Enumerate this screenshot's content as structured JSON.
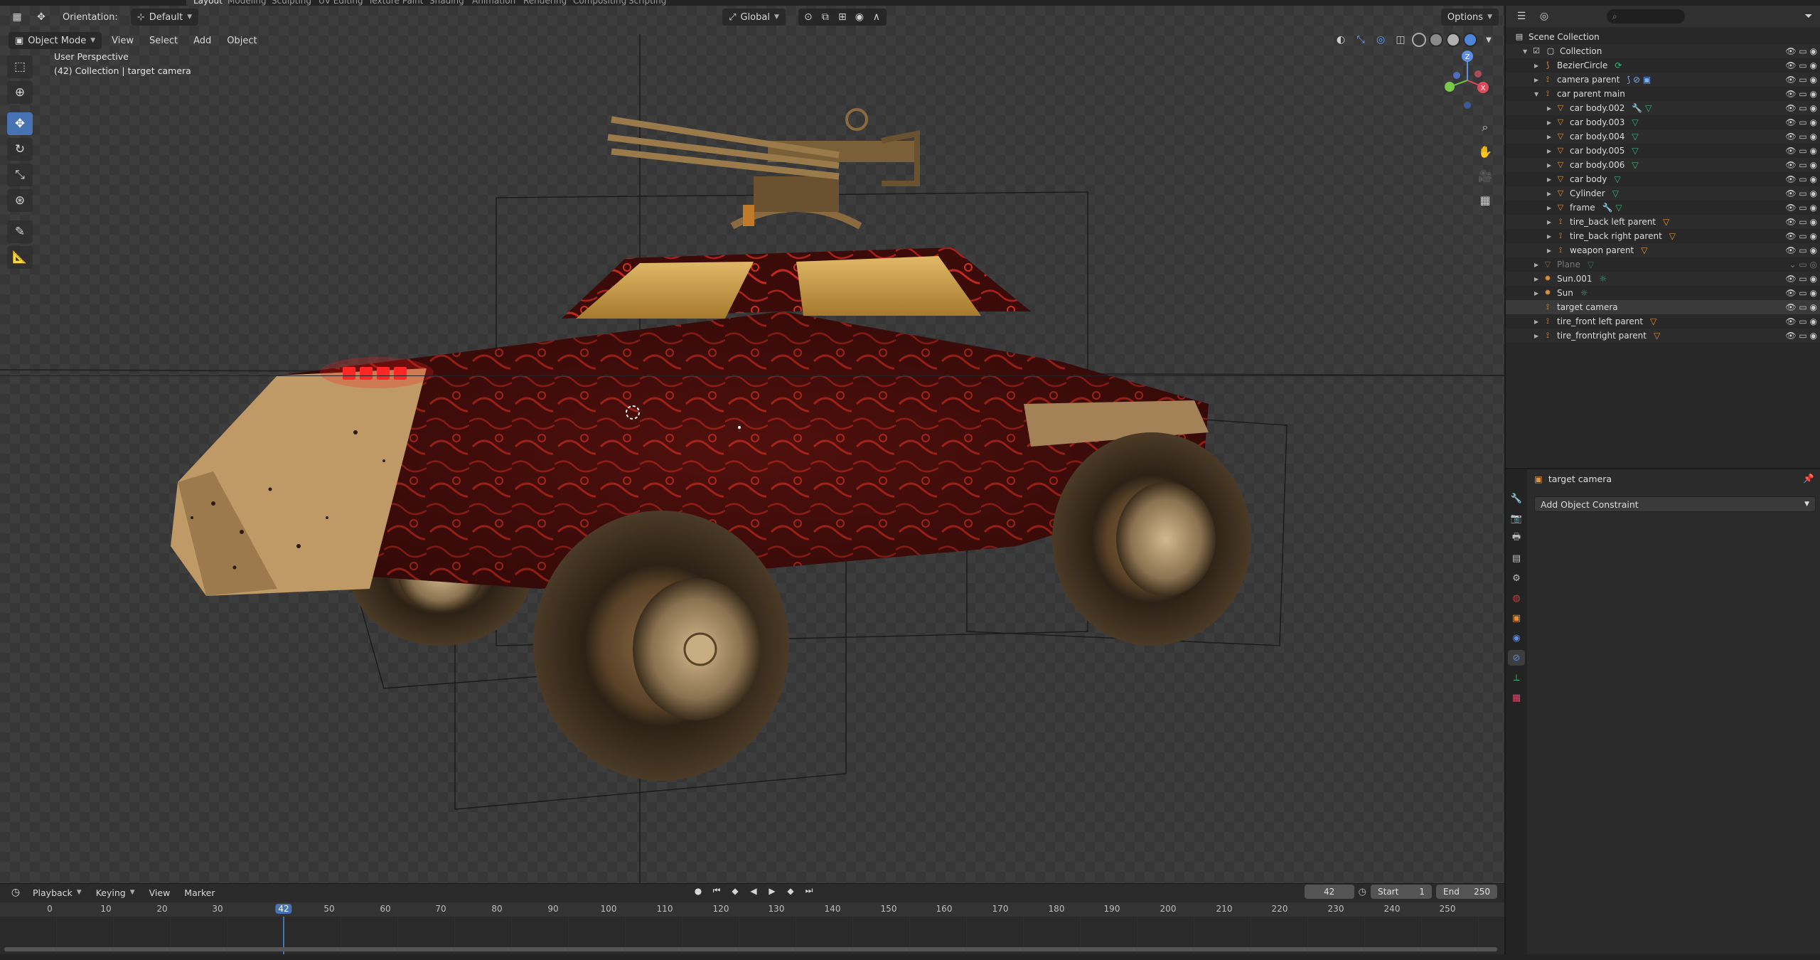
{
  "workspaces": [
    "Layout",
    "Modeling",
    "Sculpting",
    "UV Editing",
    "Texture Paint",
    "Shading",
    "Animation",
    "Rendering",
    "Compositing",
    "Scripting"
  ],
  "active_workspace": "Layout",
  "viewport": {
    "orientation_label": "Orientation:",
    "orientation_value": "Default",
    "transform_space": "Global",
    "options_label": "Options",
    "mode": "Object Mode",
    "menus": [
      "View",
      "Select",
      "Add",
      "Object"
    ],
    "overlay_line1": "User Perspective",
    "overlay_line2": "(42) Collection | target camera"
  },
  "timeline": {
    "menus": [
      "Playback",
      "Keying",
      "View",
      "Marker"
    ],
    "current_frame": "42",
    "start_label": "Start",
    "start_value": "1",
    "end_label": "End",
    "end_value": "250",
    "ticks": [
      "0",
      "10",
      "20",
      "30",
      "42",
      "50",
      "60",
      "70",
      "80",
      "90",
      "100",
      "110",
      "120",
      "130",
      "140",
      "150",
      "160",
      "170",
      "180",
      "190",
      "200",
      "210",
      "220",
      "230",
      "240",
      "250"
    ]
  },
  "outliner": {
    "root": "Scene Collection",
    "collection": "Collection",
    "items": [
      {
        "label": "BezierCircle",
        "icon": "curve-icon"
      },
      {
        "label": "camera parent",
        "icon": "empty-icon"
      },
      {
        "label": "car parent main",
        "icon": "empty-icon"
      },
      {
        "label": "car body.002",
        "icon": "mesh-icon"
      },
      {
        "label": "car body.003",
        "icon": "mesh-icon"
      },
      {
        "label": "car body.004",
        "icon": "mesh-icon"
      },
      {
        "label": "car body.005",
        "icon": "mesh-icon"
      },
      {
        "label": "car body.006",
        "icon": "mesh-icon"
      },
      {
        "label": "car body",
        "icon": "mesh-icon"
      },
      {
        "label": "Cylinder",
        "icon": "mesh-icon"
      },
      {
        "label": "frame",
        "icon": "mesh-icon"
      },
      {
        "label": "tire_back left parent",
        "icon": "empty-icon"
      },
      {
        "label": "tire_back right parent",
        "icon": "empty-icon"
      },
      {
        "label": "weapon parent",
        "icon": "empty-icon"
      },
      {
        "label": "Plane",
        "icon": "mesh-icon"
      },
      {
        "label": "Sun.001",
        "icon": "light-icon"
      },
      {
        "label": "Sun",
        "icon": "light-icon"
      },
      {
        "label": "target camera",
        "icon": "empty-icon"
      },
      {
        "label": "tire_front left parent",
        "icon": "empty-icon"
      },
      {
        "label": "tire_frontright parent",
        "icon": "empty-icon"
      }
    ]
  },
  "properties": {
    "object_name": "target camera",
    "add_constraint_label": "Add Object Constraint"
  },
  "colors": {
    "accent": "#4772b3",
    "mesh_orange": "#e0913a",
    "constraint_green": "#3fb07f"
  }
}
